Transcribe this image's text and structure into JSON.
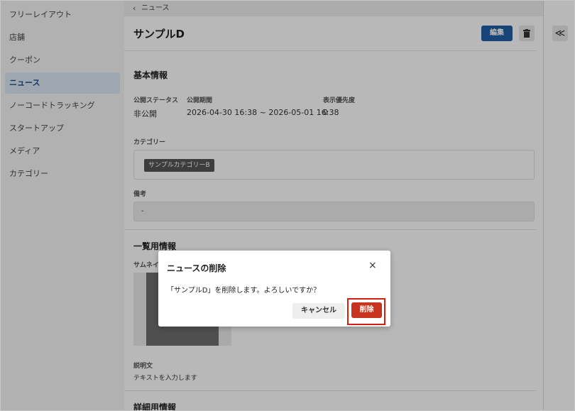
{
  "sidebar": {
    "items": [
      {
        "label": "フリーレイアウト",
        "active": false
      },
      {
        "label": "店舗",
        "active": false
      },
      {
        "label": "クーポン",
        "active": false
      },
      {
        "label": "ニュース",
        "active": true
      },
      {
        "label": "ノーコードトラッキング",
        "active": false
      },
      {
        "label": "スタートアップ",
        "active": false
      },
      {
        "label": "メディア",
        "active": false
      },
      {
        "label": "カテゴリー",
        "active": false
      }
    ]
  },
  "breadcrumb": {
    "text": "ニュース",
    "icon": "chevron-left-icon"
  },
  "header": {
    "title": "サンプルD",
    "edit_label": "編集",
    "delete_icon": "trash-icon"
  },
  "basic_info": {
    "heading": "基本情報",
    "status_label": "公開ステータス",
    "status_value": "非公開",
    "period_label": "公開期間",
    "period_value": "2026-04-30 16:38 ~ 2026-05-01 16:38",
    "priority_label": "表示優先度",
    "priority_value": "0",
    "category_label": "カテゴリー",
    "category_tag": "サンプルカテゴリーB",
    "memo_label": "備考",
    "memo_value": "-"
  },
  "list_info": {
    "heading": "一覧用情報",
    "thumbnail_label": "サムネイル",
    "description_label": "説明文",
    "description_value": "テキストを入力します"
  },
  "detail_info": {
    "heading": "詳細用情報"
  },
  "right_panel": {
    "collapse_icon": "double-chevron-left-icon",
    "collapse_glyph": "≪"
  },
  "modal": {
    "title": "ニュースの削除",
    "close_glyph": "×",
    "message": "「サンプルD」を削除します。よろしいですか？",
    "cancel_label": "キャンセル",
    "delete_label": "削除"
  },
  "colors": {
    "primary": "#1f5fa8",
    "danger": "#c8331f",
    "highlight": "#d51f10"
  }
}
